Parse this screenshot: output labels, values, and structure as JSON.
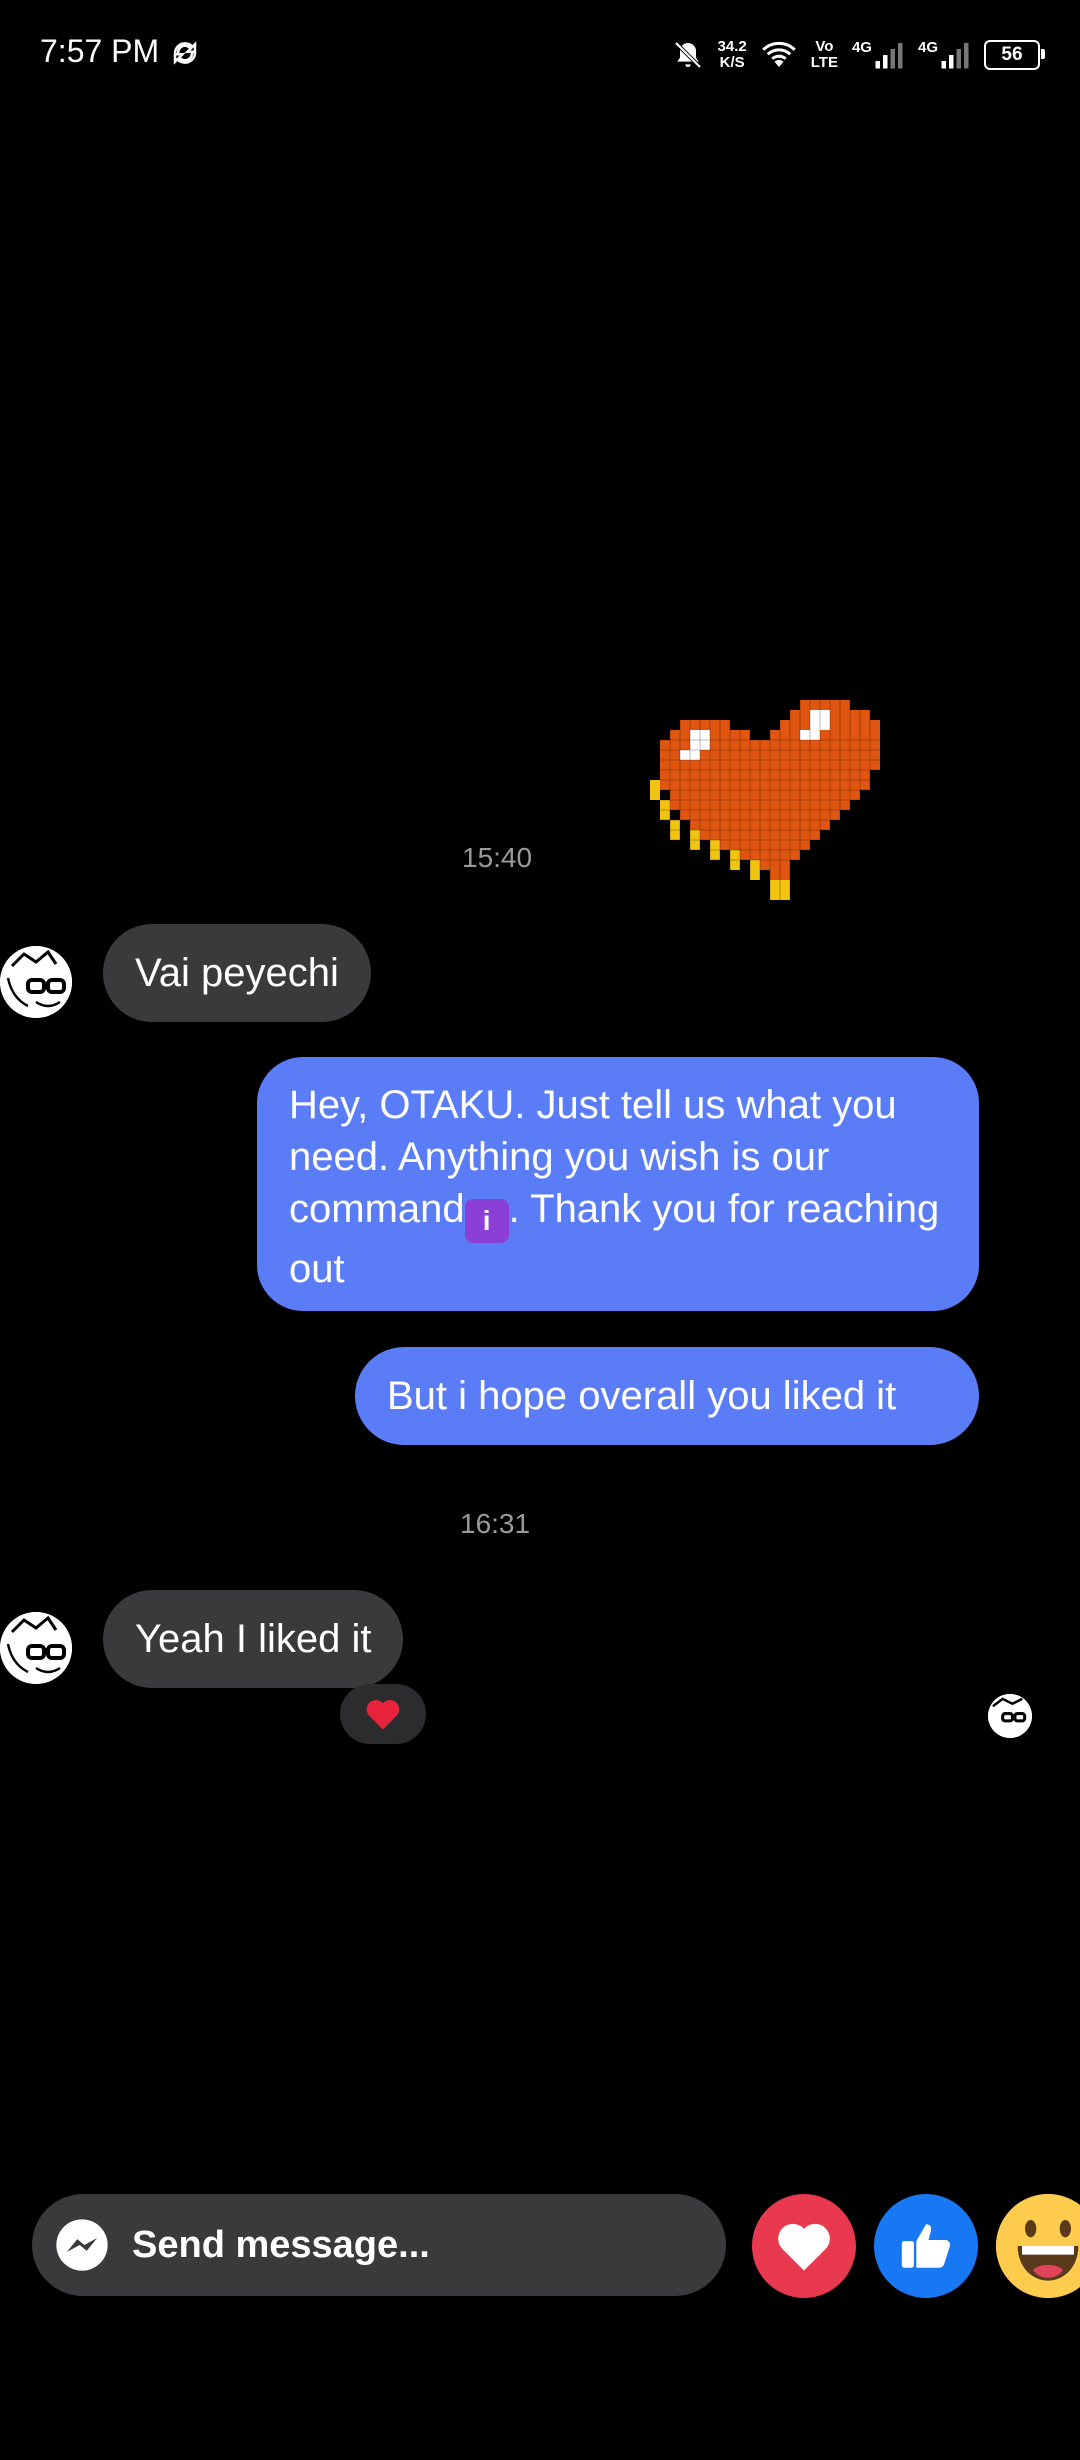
{
  "status_bar": {
    "time": "7:57 PM",
    "net_speed_value": "34.2",
    "net_speed_unit": "K/S",
    "volte_top": "Vo",
    "volte_bottom": "LTE",
    "sim1_label": "4G",
    "sim2_label": "4G",
    "battery": "56"
  },
  "conversation": {
    "timestamp_1": "15:40",
    "timestamp_2": "16:31",
    "messages": [
      {
        "from": "them",
        "text": "Vai peyechi"
      },
      {
        "from": "me",
        "text_before_emoji": "Hey, OTAKU. Just tell us what you need. Anything you wish is our command",
        "emoji": "ℹ️",
        "text_after_emoji": ". Thank you for reaching out"
      },
      {
        "from": "me",
        "text": "But i hope overall you liked it"
      },
      {
        "from": "them",
        "text": "Yeah I liked it",
        "reaction": "❤️"
      }
    ]
  },
  "composer": {
    "placeholder": "Send message..."
  },
  "colors": {
    "outgoing_bubble": "#5b7cf7",
    "incoming_bubble": "#3a3a3c",
    "love_button": "#e8394f",
    "like_button": "#1877f2"
  }
}
